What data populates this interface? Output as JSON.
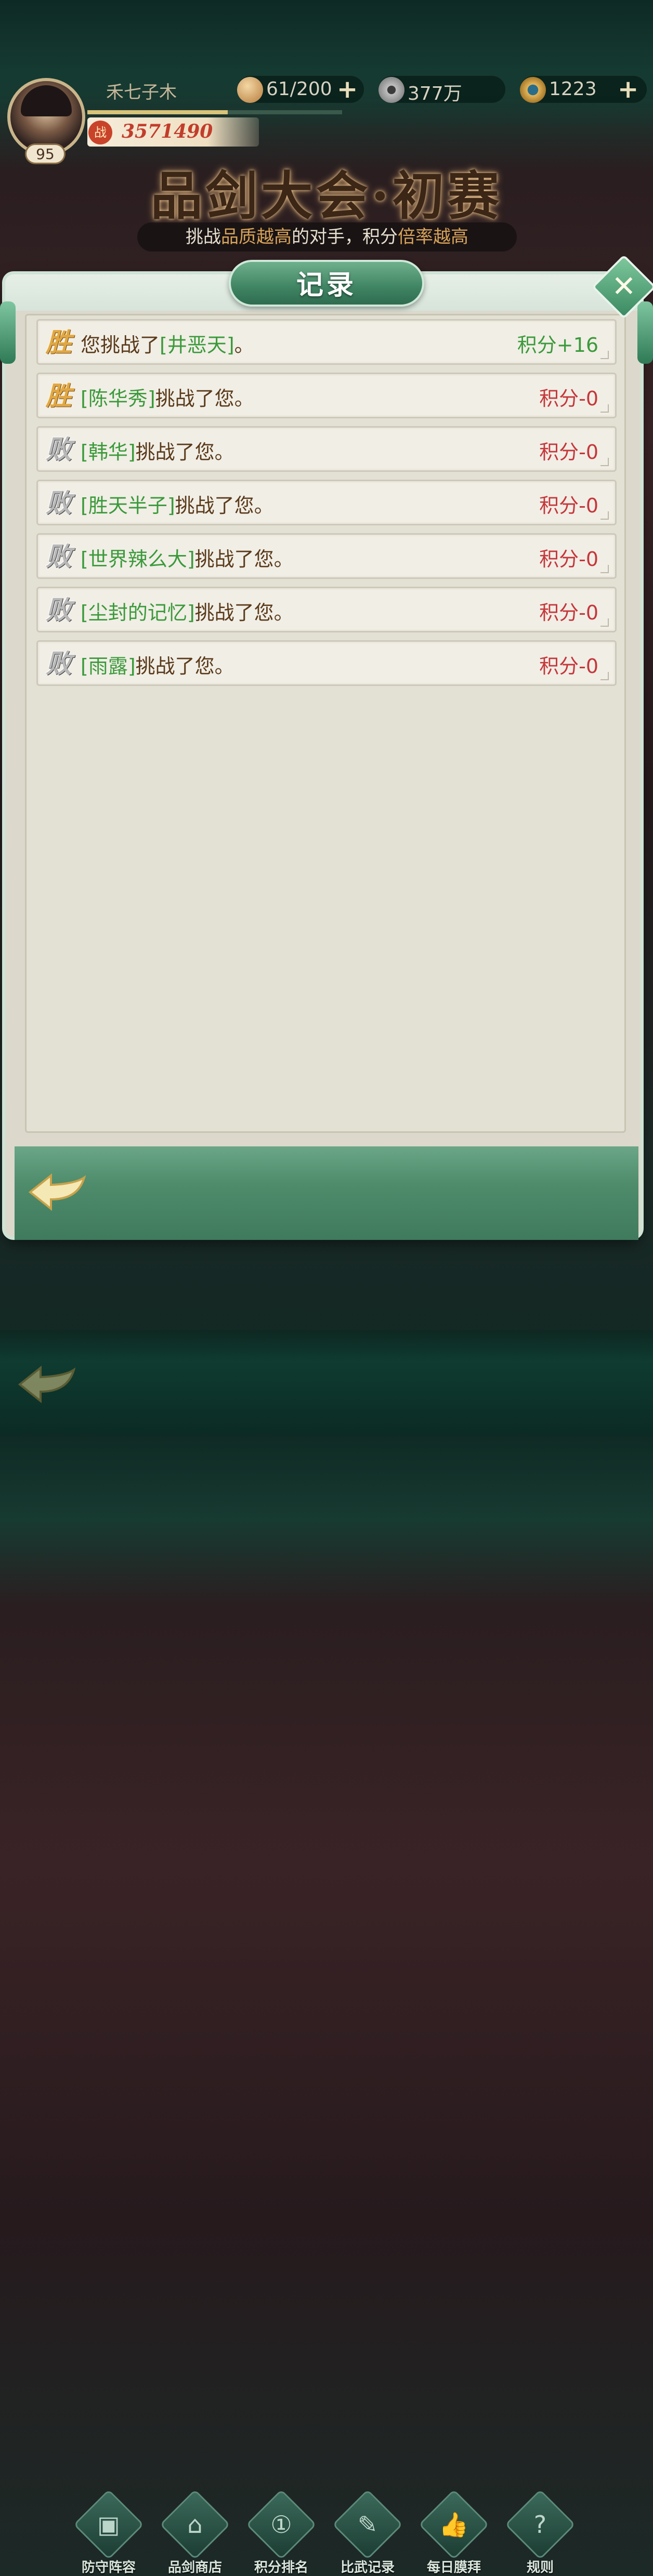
{
  "player": {
    "name": "禾七子木",
    "level": "95",
    "power_icon_text": "战",
    "power": "3571490",
    "exp_fraction": 0.55
  },
  "resources": [
    {
      "icon": "bun-icon",
      "value": "61/200"
    },
    {
      "icon": "copper-coin-icon",
      "value": "377万"
    },
    {
      "icon": "jade-ring-icon",
      "value": "1223"
    }
  ],
  "banner": {
    "title": "品剑大会·初赛",
    "subtitle_parts": [
      "挑战",
      "品质越高",
      "的对手，积分",
      "倍率越高"
    ]
  },
  "modal": {
    "title": "记录",
    "records": [
      {
        "result": "win",
        "mark": "胜",
        "prefix": "您挑战了",
        "opponent": "[井恶天]",
        "suffix": "。",
        "score": "积分+16"
      },
      {
        "result": "win",
        "mark": "胜",
        "prefix": "",
        "opponent": "[陈华秀]",
        "suffix": "挑战了您。",
        "score": "积分-0"
      },
      {
        "result": "lose",
        "mark": "败",
        "prefix": "",
        "opponent": "[韩华]",
        "suffix": "挑战了您。",
        "score": "积分-0"
      },
      {
        "result": "lose",
        "mark": "败",
        "prefix": "",
        "opponent": "[胜天半子]",
        "suffix": "挑战了您。",
        "score": "积分-0"
      },
      {
        "result": "lose",
        "mark": "败",
        "prefix": "",
        "opponent": "[世界辣么大]",
        "suffix": "挑战了您。",
        "score": "积分-0"
      },
      {
        "result": "lose",
        "mark": "败",
        "prefix": "",
        "opponent": "[尘封的记忆]",
        "suffix": "挑战了您。",
        "score": "积分-0"
      },
      {
        "result": "lose",
        "mark": "败",
        "prefix": "",
        "opponent": "[雨露]",
        "suffix": "挑战了您。",
        "score": "积分-0"
      }
    ]
  },
  "nav": [
    {
      "icon": "formation-icon",
      "label": "防守阵容"
    },
    {
      "icon": "shop-icon",
      "label": "品剑商店"
    },
    {
      "icon": "ranking-icon",
      "label": "积分排名"
    },
    {
      "icon": "battle-record-icon",
      "label": "比武记录"
    },
    {
      "icon": "thumbs-up-icon",
      "label": "每日膜拜"
    },
    {
      "icon": "rules-icon",
      "label": "规则"
    }
  ],
  "colors": {
    "win_text": "#3a9a3a",
    "lose_text": "#c5363a",
    "highlight": "#d7a35a"
  }
}
